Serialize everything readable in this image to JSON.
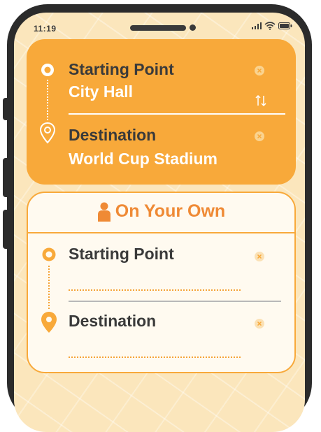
{
  "status_bar": {
    "time": "11:19"
  },
  "route_card": {
    "start_label": "Starting Point",
    "start_value": "City Hall",
    "dest_label": "Destination",
    "dest_value": "World Cup Stadium"
  },
  "own_card": {
    "title": "On Your Own",
    "start_label": "Starting Point",
    "dest_label": "Destination"
  },
  "colors": {
    "accent": "#f8a93a",
    "title_orange": "#ef8a35",
    "text_dark": "#3a3a3a",
    "background": "#fbe6bc"
  }
}
